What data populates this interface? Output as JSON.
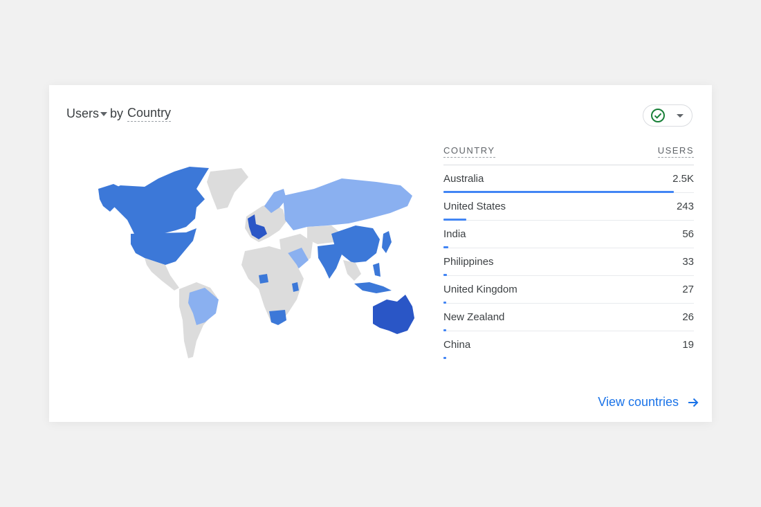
{
  "header": {
    "metric": "Users",
    "by": "by",
    "dimension": "Country"
  },
  "status_icon": "check-circle-icon",
  "table": {
    "col_country": "COUNTRY",
    "col_users": "USERS",
    "rows": [
      {
        "country": "Australia",
        "users": "2.5K",
        "share": 0.92
      },
      {
        "country": "United States",
        "users": "243",
        "share": 0.09
      },
      {
        "country": "India",
        "users": "56",
        "share": 0.02
      },
      {
        "country": "Philippines",
        "users": "33",
        "share": 0.013
      },
      {
        "country": "United Kingdom",
        "users": "27",
        "share": 0.011
      },
      {
        "country": "New Zealand",
        "users": "26",
        "share": 0.01
      },
      {
        "country": "China",
        "users": "19",
        "share": 0.008
      }
    ]
  },
  "footer": {
    "view_link": "View countries"
  },
  "colors": {
    "high": "#2a56c6",
    "mid": "#3c78d8",
    "low": "#8ab0f0",
    "none": "#dcdcdc",
    "link": "#1a73e8",
    "check": "#188038"
  }
}
